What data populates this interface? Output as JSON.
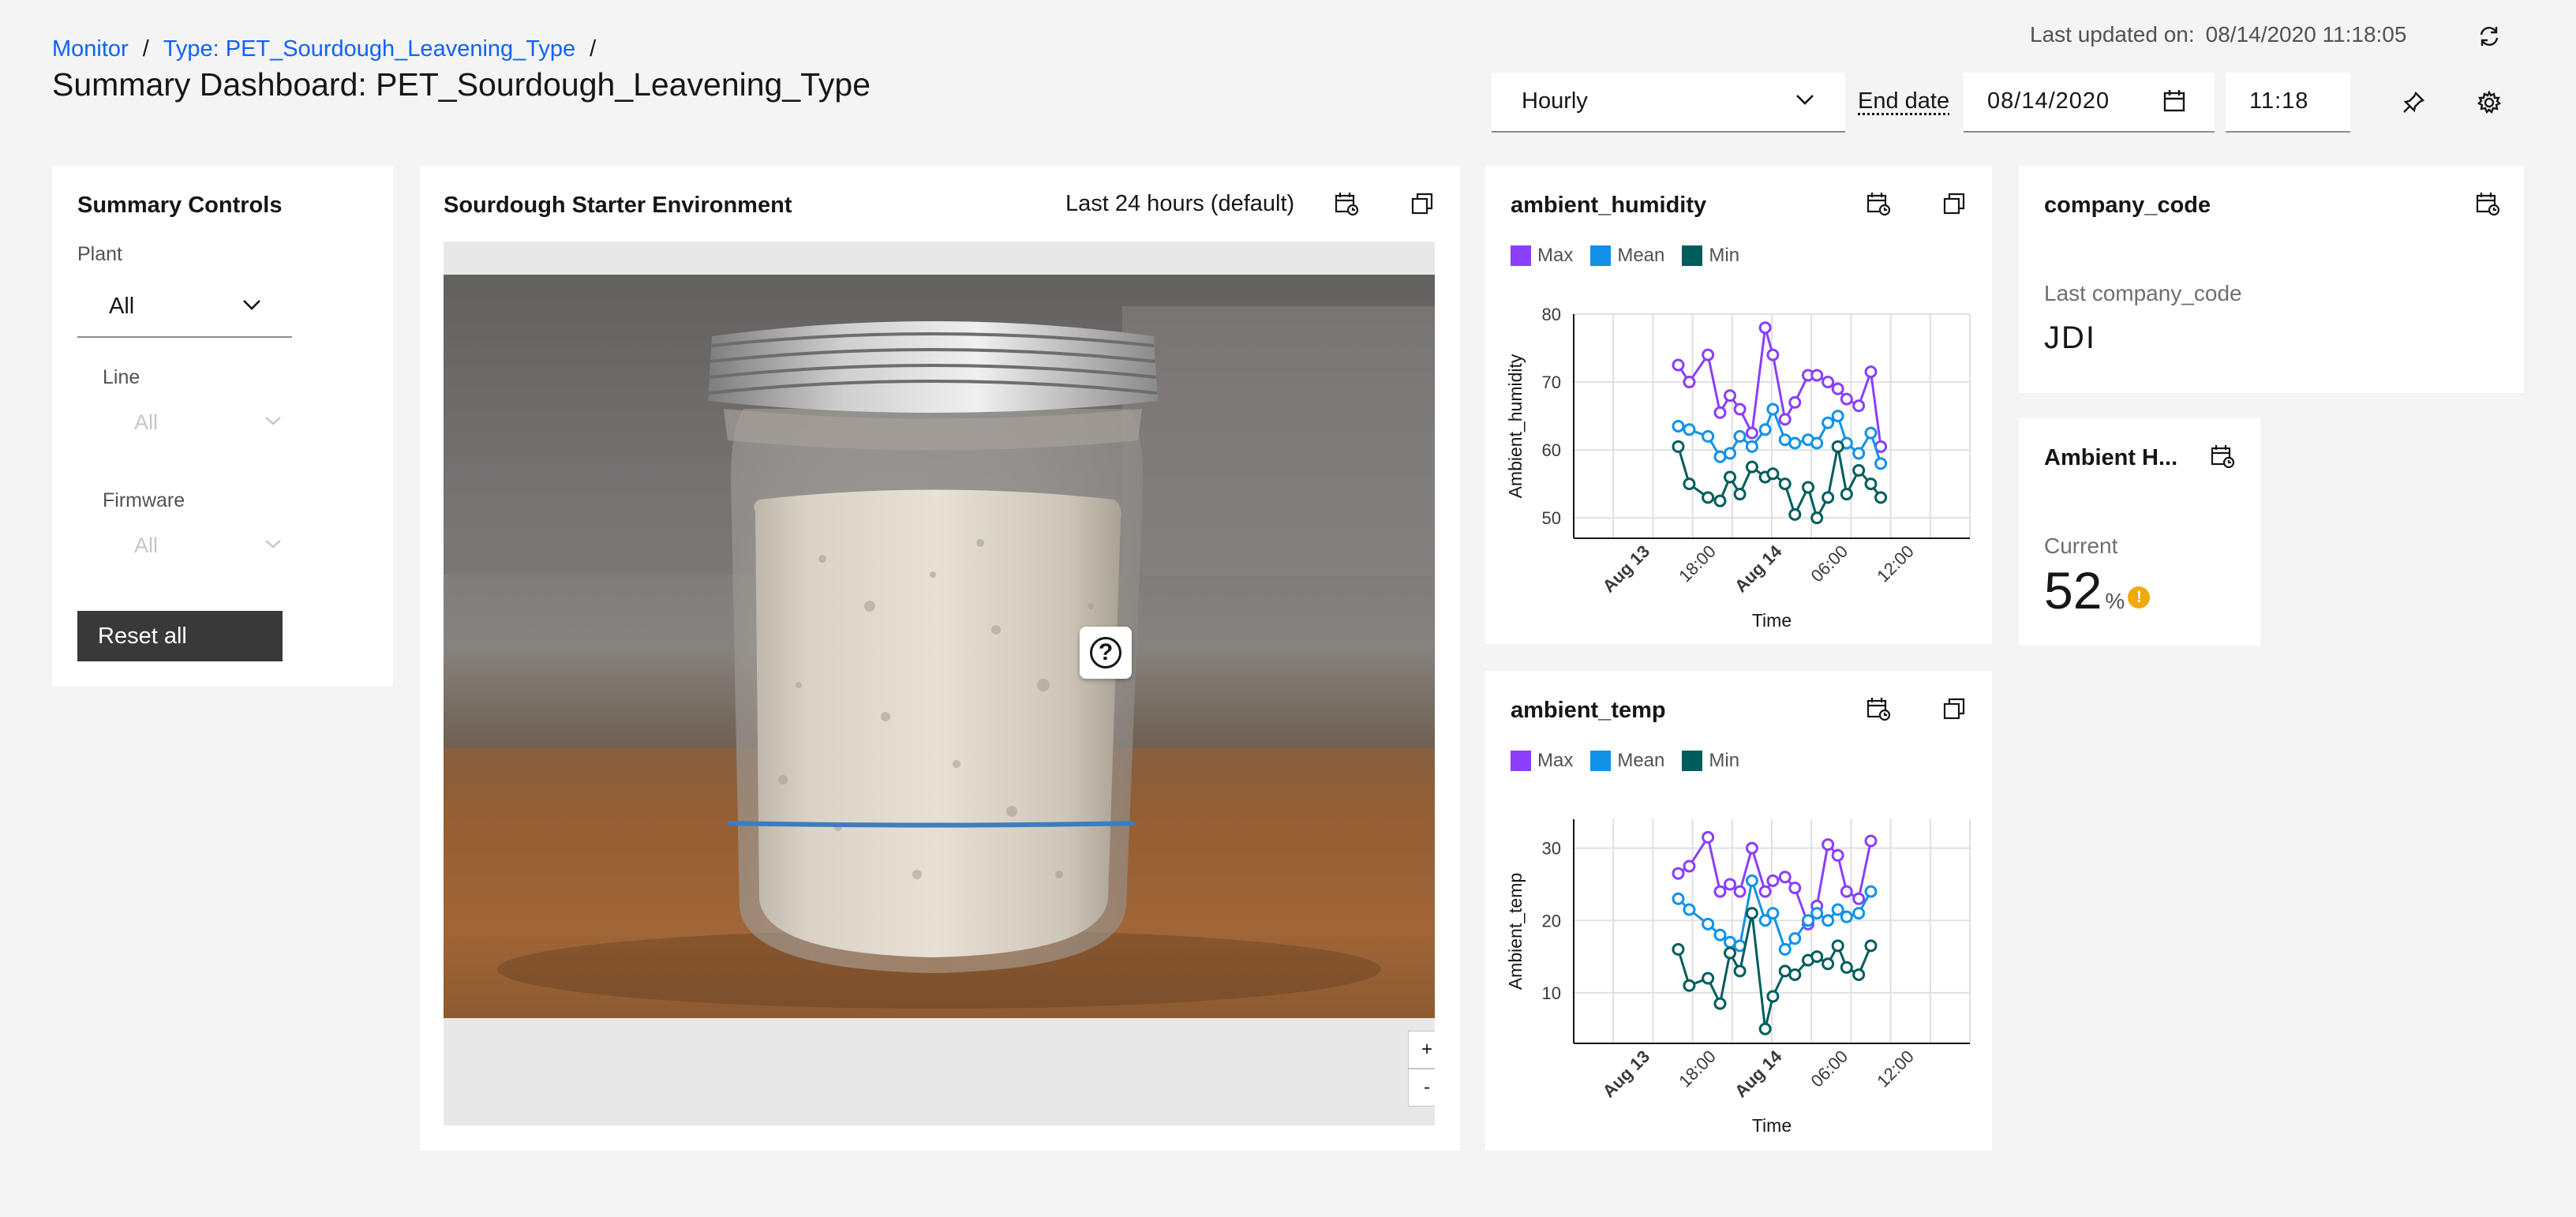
{
  "header": {
    "breadcrumb": {
      "monitor": "Monitor",
      "sep1": "/",
      "type": "Type: PET_Sourdough_Leavening_Type",
      "sep2": "/"
    },
    "title": "Summary Dashboard: PET_Sourdough_Leavening_Type",
    "last_updated_label": "Last updated on:",
    "last_updated_value": "08/14/2020 11:18:05"
  },
  "toolbar": {
    "interval": "Hourly",
    "end_date_label": "End date",
    "end_date_value": "08/14/2020",
    "end_time_value": "11:18"
  },
  "summary_controls": {
    "title": "Summary Controls",
    "plant_label": "Plant",
    "plant_value": "All",
    "line_label": "Line",
    "line_value": "All",
    "firmware_label": "Firmware",
    "firmware_value": "All",
    "reset_label": "Reset all"
  },
  "image_card": {
    "title": "Sourdough Starter Environment",
    "range": "Last 24 hours (default)",
    "zoom_in": "+",
    "zoom_out": "-",
    "help_glyph": "?"
  },
  "legend": {
    "max": "Max",
    "mean": "Mean",
    "min": "Min"
  },
  "company_card": {
    "title": "company_code",
    "last_label": "Last company_code",
    "value": "JDI"
  },
  "ambient_card": {
    "title": "Ambient H...",
    "current_label": "Current",
    "value": "52",
    "unit": "%",
    "alert_glyph": "!"
  },
  "colors": {
    "max": "#8a3ffc",
    "mean": "#1192e8",
    "min": "#005d5d",
    "link": "#0f62fe",
    "warning": "#f1a80a"
  },
  "chart_data": [
    {
      "type": "line",
      "title": "ambient_humidity",
      "xlabel": "Time",
      "ylabel": "Ambient_humidity",
      "ylim": [
        47,
        80
      ],
      "yticks": [
        50,
        60,
        70,
        80
      ],
      "xticks": [
        {
          "x": 0,
          "label": "Aug 13",
          "bold": true
        },
        {
          "x": 6,
          "label": "18:00",
          "bold": false
        },
        {
          "x": 12,
          "label": "Aug 14",
          "bold": true
        },
        {
          "x": 18,
          "label": "06:00",
          "bold": false
        },
        {
          "x": 24,
          "label": "12:00",
          "bold": false
        }
      ],
      "xlim": [
        -7,
        29
      ],
      "x": [
        2.5,
        3.5,
        5.2,
        6.3,
        7.2,
        8.1,
        9.2,
        10.4,
        11.1,
        12.2,
        13.1,
        14.3,
        15.1,
        16.1,
        17.0,
        17.8,
        18.9,
        20.0,
        20.9,
        21.8,
        23.1
      ],
      "series": [
        {
          "name": "Max",
          "color": "#8a3ffc",
          "values": [
            72.5,
            70,
            74,
            65.5,
            68,
            66,
            62.5,
            78,
            74,
            64.5,
            67,
            71,
            71,
            70,
            69,
            67.5,
            66.5,
            71.5,
            60.5,
            null,
            null
          ]
        },
        {
          "name": "Mean",
          "color": "#1192e8",
          "values": [
            63.5,
            63,
            62,
            59,
            59.5,
            62,
            60.5,
            63,
            66,
            61.5,
            61,
            61.5,
            61,
            64,
            65,
            61,
            59.5,
            62.5,
            58,
            null,
            null
          ]
        },
        {
          "name": "Min",
          "color": "#005d5d",
          "values": [
            60.5,
            55,
            53,
            52.5,
            56,
            53.5,
            57.5,
            56,
            56.5,
            55,
            50.5,
            54.5,
            50,
            53,
            60.5,
            53.5,
            57,
            55,
            53,
            null,
            null
          ]
        }
      ]
    },
    {
      "type": "line",
      "title": "ambient_temp",
      "xlabel": "Time",
      "ylabel": "Ambient_temp",
      "ylim": [
        3,
        34
      ],
      "yticks": [
        10,
        20,
        30
      ],
      "xticks": [
        {
          "x": 0,
          "label": "Aug 13",
          "bold": true
        },
        {
          "x": 6,
          "label": "18:00",
          "bold": false
        },
        {
          "x": 12,
          "label": "Aug 14",
          "bold": true
        },
        {
          "x": 18,
          "label": "06:00",
          "bold": false
        },
        {
          "x": 24,
          "label": "12:00",
          "bold": false
        }
      ],
      "xlim": [
        -7,
        29
      ],
      "x": [
        2.5,
        3.5,
        5.2,
        6.3,
        7.2,
        8.1,
        9.2,
        10.4,
        11.1,
        12.2,
        13.1,
        14.3,
        15.1,
        16.1,
        17.0,
        17.8,
        18.9,
        20.0,
        20.9,
        21.8,
        23.1
      ],
      "series": [
        {
          "name": "Max",
          "color": "#8a3ffc",
          "values": [
            26.5,
            27.5,
            31.5,
            24,
            25,
            24,
            30,
            24,
            25.5,
            26,
            24.5,
            19.5,
            22,
            30.5,
            29,
            24,
            23,
            31,
            null,
            null,
            null
          ]
        },
        {
          "name": "Mean",
          "color": "#1192e8",
          "values": [
            23,
            21.5,
            19.5,
            18,
            17,
            16.5,
            25.5,
            20,
            21,
            16,
            17.5,
            20,
            21,
            20,
            21.5,
            20.5,
            21,
            24,
            null,
            null,
            null
          ]
        },
        {
          "name": "Min",
          "color": "#005d5d",
          "values": [
            16,
            11,
            12,
            8.5,
            15.5,
            13,
            21,
            5,
            9.5,
            13,
            12.5,
            14.5,
            15,
            14,
            16.5,
            13.5,
            12.5,
            16.5,
            null,
            null,
            null
          ]
        }
      ]
    }
  ]
}
